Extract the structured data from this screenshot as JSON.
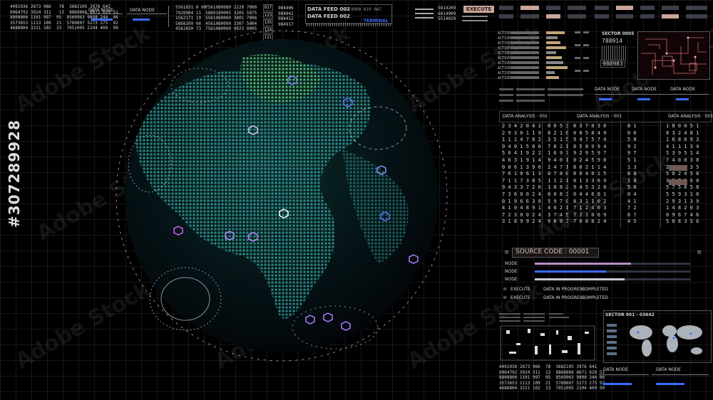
{
  "watermark": {
    "text": "Adobe Stock",
    "id_number": "#307289928"
  },
  "top_left": {
    "numbers_block": "4491936 2673 966   78  3682105 3976 641\n6064792 3924 311   13  8868866 8671 629 51\n8808806 1101 997  95  8569963 9898 244  06\n3573653 1113 109  21  5789607 5273 275  92\n4688804 3221 102  33  7051005 2104 409  99",
    "data_node_1": "DATA NODE",
    "data_node_2": "DATA NODE"
  },
  "top_center": {
    "numbers_a": "5561831 0 00\n7928904 11\n1562171 19\n5868109 06\n4562830 73",
    "numbers_b": "7561080080 2220 7000\n5860109005 3205 5975\n5561060004 3801 7006\n4561080090 3307 5004\n7561080000 9023 8005",
    "code_boxes": [
      "817",
      "123",
      "135",
      "134",
      "111"
    ],
    "side_numbers": "984406\n984042\n984412\n984917",
    "data_feed_1": "DATA FEED 001",
    "data_feed_2": "DATA FEED 002",
    "feed_values_1": "5574098 810 0A7",
    "terminal": "TERMINAL",
    "execute": "EXECUTE",
    "exec_numbers": "5814209\n6814909\n5514029"
  },
  "sector_0005": {
    "title": "SECTOR 0005",
    "digits_a": "788914",
    "digits_b": "988983",
    "active_label": "ACTIVE",
    "rows": 10
  },
  "data_nodes_mid": [
    "DATA NODE",
    "DATA NODE",
    "DATA NODE"
  ],
  "data_analysis": {
    "headers": [
      "DATA ANALYSIS · 002",
      "DATA ANALYSIS · 003",
      "DATA ANALYSIS · 003"
    ],
    "columns": [
      "2 3 4 2 0 4 1\n2 9 3 0 1 1 9\n1 1 1 4 7 0 2\n9 4 0 1 5 0 6\n5 0 4 1 9 2 2\n4 6 3 1 9 1 4\n0 0 6 1 3 9 6\n7 6 1 0 6 1 3\n7 1 1 7 3 8 5\n9 4 3 3 7 2 0\n7 3 6 0 0 2 4\n0 1 9 6 6 3 0\n4 1 0 4 8 9 1\n7 2 3 0 0 2 4\n3 1 8 9 9 2 4",
      "0 0 5 3\n8 2 1 6\n3 5 1 5\n7 8 2 1\n1 6 9 7\n9 4 0 1\n2 4 7 1\n0 7 8 8\n1 1 2 1\n1 0 8 2\n0 0 8 3\n5 9 7 0\n4 6 2 1\n3 7 4 5\n9 6 0 3",
      "8 3 7 0 3 0\n0 0 5 8 4 9\n9 4 7 5 7 4\n8 5 8 9 9 4\n9 2 9 5 9 7\n0 2 4 5 9 8\n8 0 2 1 1 4\n8 0 4 0 1 5\n0 1 3 3 6 9\n9 4 5 3 2 0\n0 4 4 6 0 1\n8 3 1 1 0 2\n7 1 2 4 0 3\n7 2 1 0 6 9\n7 8 8 8 2 4",
      "8 1\n0 6\n5 8\n9 2\n9 7\n5 1\n1 3\n8 8\n1 8\n5 8\n0 4\n4 1\n7 2\n6 7\n4 5",
      "1 8 0 0 5 1\n8 3 2 4 8 1\n1 6 8 0 9 3\n4 1 1 1 3 4\n5 3 9 5 1 4\n7 4 0 8 3 8\n2 5 4 9 3 5\n5 0 2 4 5 8\n3 8 7 1 6 0\n5 7 5 6 5 8\n5 5 9 3 1 0\n2 9 3 1 3 9\n1 4 8 2 0 3\n0 9 6 7 4 6\n5 0 8 3 5 6"
    ]
  },
  "source_code": {
    "title": "SOURCE CODE : 00001",
    "nodes": [
      {
        "label": "NODE",
        "value": 0.62,
        "color": "#b98fc9"
      },
      {
        "label": "NODE",
        "value": 0.46,
        "color": "#3a6cff"
      },
      {
        "label": "NODE",
        "value": 0.58,
        "color": "#c9c9d4"
      }
    ],
    "exec_lines": [
      {
        "a": "EXECUTE",
        "b": "DATA IN PROGRESS",
        "c": "COMPLETED"
      },
      {
        "a": "EXECUTE",
        "b": "DATA IN PROGRESS",
        "c": "COMPLETED"
      }
    ]
  },
  "sector_map": {
    "title": "SECTOR 001 - 03642"
  },
  "bottom_right": {
    "numbers_block": "4491936 2673 966  78  3682105 3976 641\n6064792 3924 311  13  8868866 8671 629 51\n8808806 1101 997  95  8569963 9898 244 06\n3573653 1113 109  21  5789607 5273 275 92\n4688804 3221 102  33  7051005 2104 409 99",
    "data_node_1": "DATA NODE",
    "data_node_2": "DATA NODE"
  }
}
